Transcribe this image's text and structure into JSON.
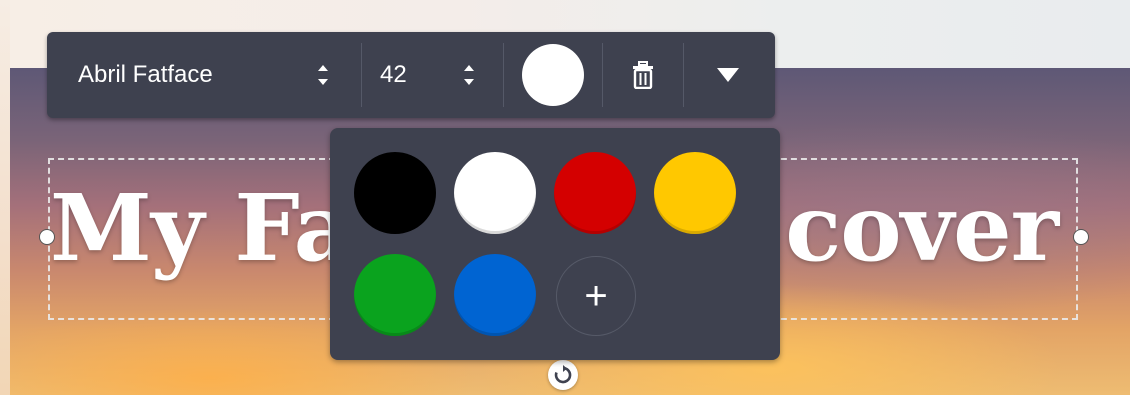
{
  "canvas": {
    "heading_left": "My Fa",
    "heading_right": "cover"
  },
  "toolbar": {
    "font_family": "Abril Fatface",
    "font_size": "42",
    "current_color": "#ffffff",
    "delete_icon": "trash-icon",
    "more_icon": "caret-down-icon"
  },
  "color_popup": {
    "swatches": [
      "#000000",
      "#ffffff",
      "#d40000",
      "#ffc800",
      "#0aa31e",
      "#0064d2"
    ],
    "add_label": "+"
  }
}
